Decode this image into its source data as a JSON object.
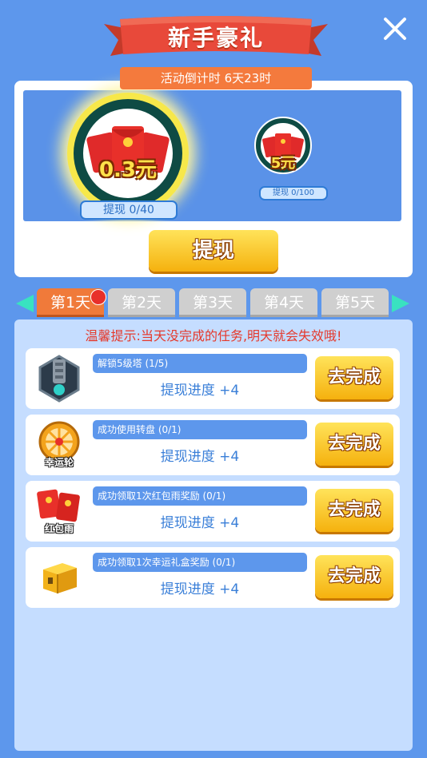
{
  "header": {
    "title": "新手豪礼",
    "countdown": "活动倒计时 6天23时",
    "close_icon": "close-icon",
    "banner_color": "#e8493a"
  },
  "rewards": [
    {
      "value": "0.3元",
      "withdraw": "提现 0/40"
    },
    {
      "value": "5元",
      "withdraw": "提现 0/100"
    }
  ],
  "withdraw_button": "提现",
  "tabs": [
    {
      "label": "第1天",
      "active": true,
      "badge": true
    },
    {
      "label": "第2天",
      "active": false
    },
    {
      "label": "第3天",
      "active": false
    },
    {
      "label": "第4天",
      "active": false
    },
    {
      "label": "第5天",
      "active": false
    }
  ],
  "tip": "温馨提示:当天没完成的任务,明天就会失效哦!",
  "tasks": [
    {
      "name": "解锁5级塔 (1/5)",
      "progress": "提现进度 +4",
      "button": "去完成",
      "icon": "tower-icon",
      "icon_caption": ""
    },
    {
      "name": "成功使用转盘 (0/1)",
      "progress": "提现进度 +4",
      "button": "去完成",
      "icon": "lucky-wheel-icon",
      "icon_caption": "幸运轮"
    },
    {
      "name": "成功领取1次红包雨奖励 (0/1)",
      "progress": "提现进度 +4",
      "button": "去完成",
      "icon": "red-packet-rain-icon",
      "icon_caption": "红包雨"
    },
    {
      "name": "成功领取1次幸运礼盒奖励 (0/1)",
      "progress": "提现进度 +4",
      "button": "去完成",
      "icon": "gift-box-icon",
      "icon_caption": ""
    }
  ],
  "colors": {
    "background": "#5d97ec",
    "accent_orange": "#f07a3a",
    "button_yellow": "#f5b10e",
    "tip_red": "#e5392b"
  }
}
